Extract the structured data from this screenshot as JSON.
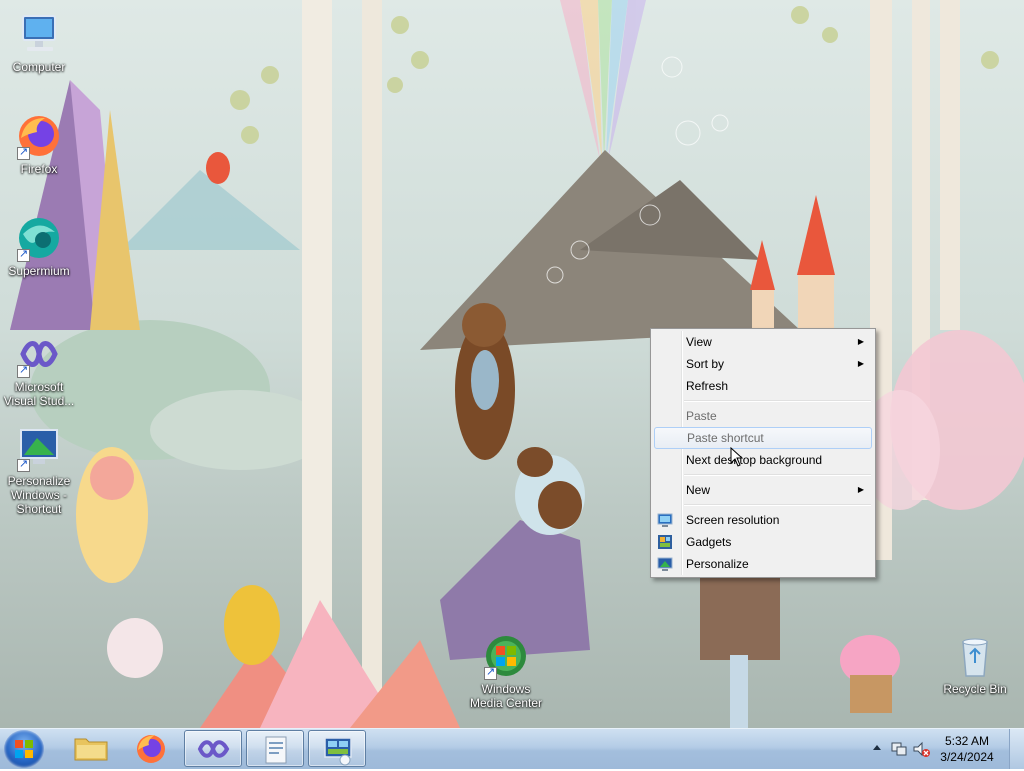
{
  "desktop": {
    "icons": [
      {
        "label": "Computer"
      },
      {
        "label": "Firefox"
      },
      {
        "label": "Supermium"
      },
      {
        "label": "Microsoft Visual Stud..."
      },
      {
        "label": "Personalize Windows - Shortcut"
      },
      {
        "label": "Windows Media Center"
      },
      {
        "label": "Recycle Bin"
      }
    ]
  },
  "context_menu": {
    "items": [
      {
        "label": "View",
        "submenu": true,
        "enabled": true
      },
      {
        "label": "Sort by",
        "submenu": true,
        "enabled": true
      },
      {
        "label": "Refresh",
        "enabled": true
      },
      {
        "label": "Paste",
        "enabled": false
      },
      {
        "label": "Paste shortcut",
        "enabled": false
      },
      {
        "label": "Next desktop background",
        "enabled": true
      },
      {
        "label": "New",
        "submenu": true,
        "enabled": true
      },
      {
        "label": "Screen resolution",
        "icon": "monitor-icon",
        "enabled": true
      },
      {
        "label": "Gadgets",
        "icon": "gadgets-icon",
        "enabled": true
      },
      {
        "label": "Personalize",
        "icon": "personalize-icon",
        "enabled": true
      }
    ]
  },
  "taskbar": {
    "pinned": [
      {
        "name": "Windows Explorer",
        "icon": "folder-icon"
      },
      {
        "name": "Firefox",
        "icon": "firefox-icon"
      },
      {
        "name": "Microsoft Visual Studio",
        "icon": "visual-studio-icon"
      },
      {
        "name": "Document",
        "icon": "document-icon"
      },
      {
        "name": "Personalize",
        "icon": "personalize-icon"
      }
    ],
    "clock": {
      "time": "5:32 AM",
      "date": "3/24/2024"
    }
  },
  "colors": {
    "taskbar": "#b4cce6",
    "menu_bg": "#f0f0f0",
    "highlight_border": "#aecff7"
  }
}
